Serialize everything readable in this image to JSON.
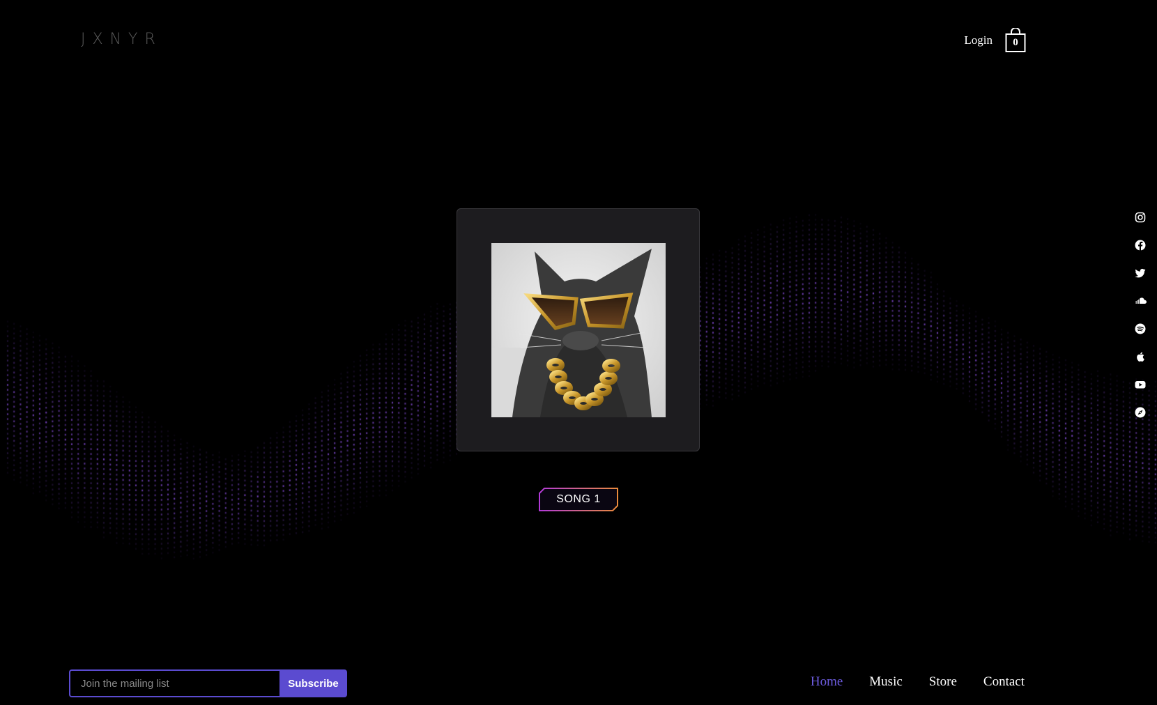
{
  "header": {
    "logo": "JXNYR",
    "login_label": "Login",
    "cart_count": "0"
  },
  "player": {
    "album_art_alt": "cat with gold sunglasses and chain",
    "song_label": "SONG 1"
  },
  "social": [
    "instagram-icon",
    "facebook-icon",
    "twitter-icon",
    "soundcloud-icon",
    "spotify-icon",
    "apple-icon",
    "youtube-icon",
    "compass-icon"
  ],
  "mailing": {
    "placeholder": "Join the mailing list",
    "button_label": "Subscribe"
  },
  "nav": {
    "items": [
      {
        "label": "Home"
      },
      {
        "label": "Music"
      },
      {
        "label": "Store"
      },
      {
        "label": "Contact"
      }
    ]
  },
  "colors": {
    "accent": "#5b4bd0",
    "nav_active": "#6d5ce0",
    "wave": "#8a4fe0"
  }
}
